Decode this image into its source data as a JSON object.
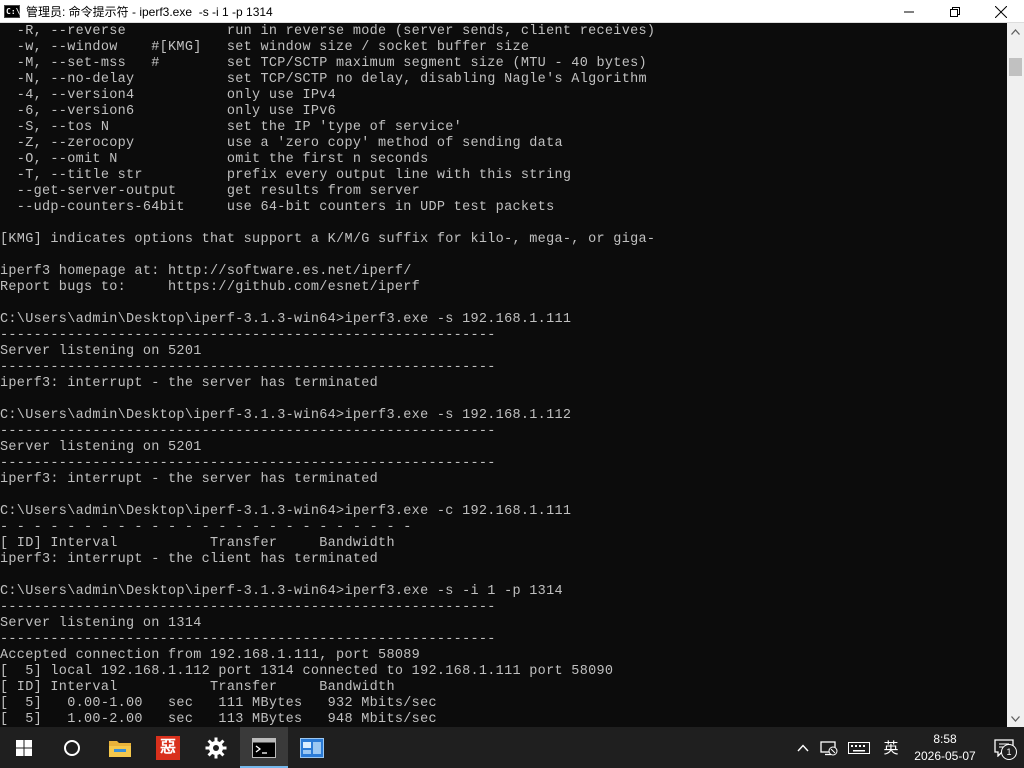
{
  "window": {
    "title": "管理员: 命令提示符 - iperf3.exe  -s -i 1 -p 1314",
    "icon_label": "C:\\"
  },
  "console": {
    "lines": [
      "  -R, --reverse            run in reverse mode (server sends, client receives)",
      "  -w, --window    #[KMG]   set window size / socket buffer size",
      "  -M, --set-mss   #        set TCP/SCTP maximum segment size (MTU - 40 bytes)",
      "  -N, --no-delay           set TCP/SCTP no delay, disabling Nagle's Algorithm",
      "  -4, --version4           only use IPv4",
      "  -6, --version6           only use IPv6",
      "  -S, --tos N              set the IP 'type of service'",
      "  -Z, --zerocopy           use a 'zero copy' method of sending data",
      "  -O, --omit N             omit the first n seconds",
      "  -T, --title str          prefix every output line with this string",
      "  --get-server-output      get results from server",
      "  --udp-counters-64bit     use 64-bit counters in UDP test packets",
      "",
      "[KMG] indicates options that support a K/M/G suffix for kilo-, mega-, or giga-",
      "",
      "iperf3 homepage at: http://software.es.net/iperf/",
      "Report bugs to:     https://github.com/esnet/iperf",
      "",
      "C:\\Users\\admin\\Desktop\\iperf-3.1.3-win64>iperf3.exe -s 192.168.1.111",
      "-----------------------------------------------------------",
      "Server listening on 5201",
      "-----------------------------------------------------------",
      "iperf3: interrupt - the server has terminated",
      "",
      "C:\\Users\\admin\\Desktop\\iperf-3.1.3-win64>iperf3.exe -s 192.168.1.112",
      "-----------------------------------------------------------",
      "Server listening on 5201",
      "-----------------------------------------------------------",
      "iperf3: interrupt - the server has terminated",
      "",
      "C:\\Users\\admin\\Desktop\\iperf-3.1.3-win64>iperf3.exe -c 192.168.1.111",
      "- - - - - - - - - - - - - - - - - - - - - - - - -",
      "[ ID] Interval           Transfer     Bandwidth",
      "iperf3: interrupt - the client has terminated",
      "",
      "C:\\Users\\admin\\Desktop\\iperf-3.1.3-win64>iperf3.exe -s -i 1 -p 1314",
      "-----------------------------------------------------------",
      "Server listening on 1314",
      "-----------------------------------------------------------",
      "Accepted connection from 192.168.1.111, port 58089",
      "[  5] local 192.168.1.112 port 1314 connected to 192.168.1.111 port 58090",
      "[ ID] Interval           Transfer     Bandwidth",
      "[  5]   0.00-1.00   sec   111 MBytes   932 Mbits/sec",
      "[  5]   1.00-2.00   sec   113 MBytes   948 Mbits/sec"
    ]
  },
  "taskbar": {
    "apps": [
      {
        "name": "start",
        "icon": "windows-logo-icon",
        "active": false
      },
      {
        "name": "search",
        "icon": "cortana-circle-icon",
        "active": false
      },
      {
        "name": "file-explorer",
        "icon": "folder-icon",
        "active": false
      },
      {
        "name": "app-red",
        "icon": "red-app-icon",
        "label": "惡",
        "active": false
      },
      {
        "name": "settings",
        "icon": "gear-icon",
        "active": false
      },
      {
        "name": "command-prompt",
        "icon": "cmd-icon",
        "active": true
      },
      {
        "name": "remote-app",
        "icon": "blue-window-icon",
        "active": false
      }
    ],
    "tray": {
      "chevron": "^",
      "ime_label": "英",
      "time": "8:58",
      "date": "2026-05-07",
      "notification_count": "1"
    }
  }
}
